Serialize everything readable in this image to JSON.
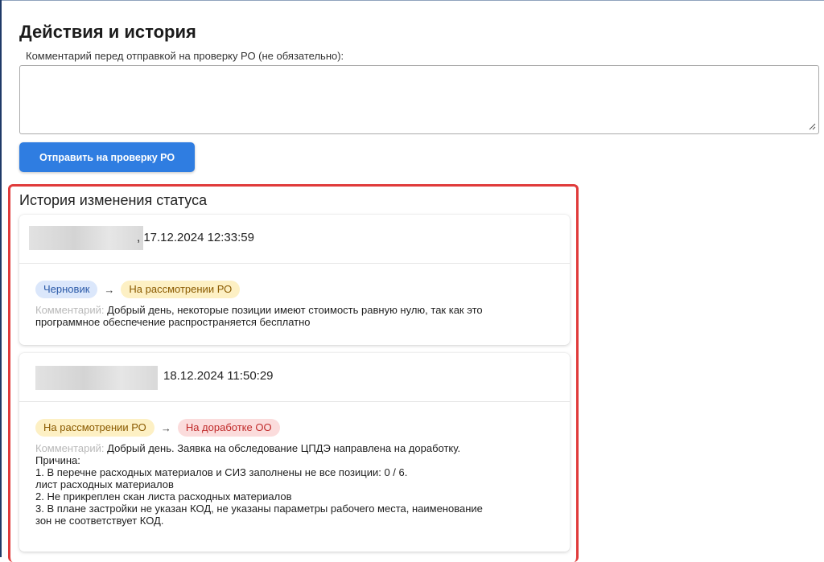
{
  "section": {
    "title": "Действия и история",
    "comment_label": "Комментарий перед отправкой на проверку РО (не обязательно):",
    "comment_value": "",
    "submit_label": "Отправить на проверку РО"
  },
  "history": {
    "title": "История изменения статуса",
    "entries": [
      {
        "datetime": ", 17.12.2024 12:33:59",
        "from_status": "Черновик",
        "arrow": "→",
        "to_status": "На рассмотрении РО",
        "comment_label": "Комментарий:",
        "comment": "Добрый день, некоторые позиции имеют стоимость равную нулю, так как это\nпрограммное обеспечение распространяется бесплатно"
      },
      {
        "datetime": "18.12.2024 11:50:29",
        "from_status": "На рассмотрении РО",
        "arrow": "→",
        "to_status": "На доработке ОО",
        "comment_label": "Комментарий:",
        "comment": "Добрый день. Заявка на обследование ЦПДЭ направлена на доработку.\nПричина:\n1. В перечне расходных материалов и СИЗ заполнены не все позиции: 0 / 6.\nлист расходных материалов\n2. Не прикреплен  скан листа расходных материалов\n3. В плане застройки не указан КОД, не указаны параметры рабочего места, наименование\nзон не соответствует КОД."
      }
    ]
  },
  "colors": {
    "button": "#2f7de1",
    "highlight_border": "#e03b3b",
    "badge_draft": "#dbe7fb",
    "badge_review": "#fdf0c4",
    "badge_rework": "#fbdcdc"
  }
}
